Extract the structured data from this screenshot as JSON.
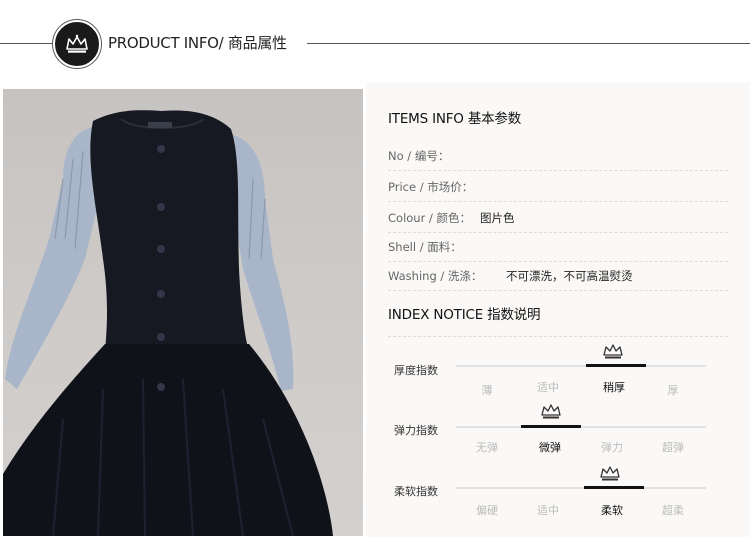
{
  "header": {
    "title_en": "PRODUCT INFO/",
    "title_cn": " 商品属性"
  },
  "items_info": {
    "title": "ITEMS INFO 基本参数",
    "rows": [
      {
        "label": "No / 编号：",
        "value": ""
      },
      {
        "label": "Price / 市场价：",
        "value": ""
      },
      {
        "label": "Colour / 颜色：",
        "value": "图片色"
      },
      {
        "label": "Shell / 面料：",
        "value": ""
      },
      {
        "label": "Washing / 洗涤：",
        "value": "不可漂洗，不可高温熨烫"
      }
    ]
  },
  "index_notice": {
    "title": "INDEX NOTICE 指数说明",
    "indices": [
      {
        "label": "厚度指数",
        "options": [
          "薄",
          "适中",
          "稍厚",
          "厚"
        ],
        "selected": 2
      },
      {
        "label": "弹力指数",
        "options": [
          "无弹",
          "微弹",
          "弹力",
          "超弹"
        ],
        "selected": 1
      },
      {
        "label": "柔软指数",
        "options": [
          "偏硬",
          "适中",
          "柔软",
          "超柔"
        ],
        "selected": 2
      }
    ]
  },
  "colors": {
    "dress": "#14161f",
    "sleeve": "#a6b3c6",
    "photo_bg": "#cac7c5",
    "panel_bg": "#fbf9f7"
  }
}
